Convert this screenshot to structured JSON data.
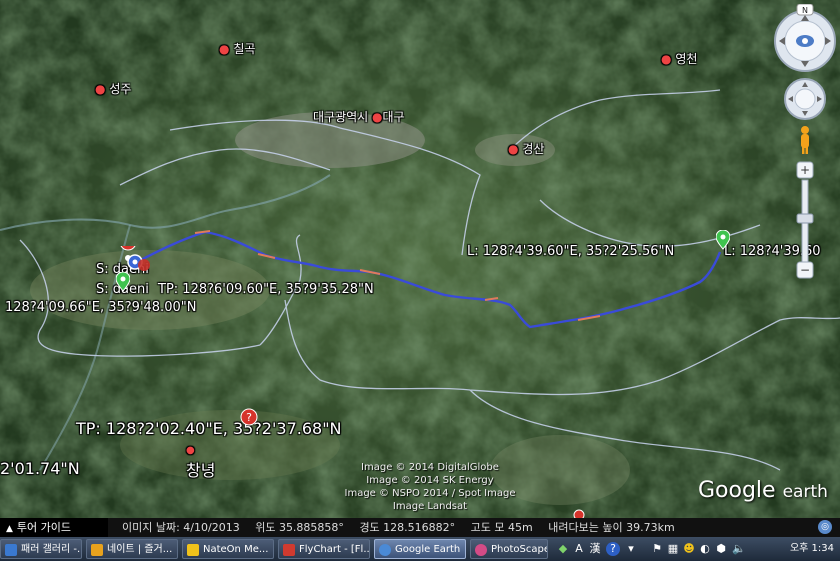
{
  "map": {
    "places": {
      "daegu_metro": "대구광역시",
      "daegu": "대구",
      "gyeongsan": "경산",
      "seongju": "성주",
      "chilgok": "칠곡",
      "yeongcheon": "영천",
      "changnyeong": "창녕"
    },
    "placemarks": {
      "start1": "S: daeni",
      "start2": "S: daeni",
      "tp_top": "TP: 128?6'09.60\"E, 35?9'35.28\"N",
      "left_coord": "128?4'09.66\"E, 35?9'48.00\"N",
      "end_label_1": "L: 128?4'39.60\"E, 35?2'25.56\"N",
      "end_label_2": "L: 128?4'39.60",
      "tp_bottom": "TP: 128?2'02.40\"E, 35?2'37.68\"N",
      "bottom_left_coord": "2'01.74\"N"
    },
    "copyright": [
      "Image © 2014 DigitalGlobe",
      "Image © 2014 SK Energy",
      "Image © NSPO 2014 / Spot Image",
      "Image Landsat"
    ],
    "logo": {
      "main": "Google",
      "sub": "earth"
    },
    "colors": {
      "track": "#3a4bd8",
      "track_accent": "#e07b5a",
      "border": "#c9d4f0",
      "pin_red": "#d6332b",
      "pin_green": "#3fc34f"
    }
  },
  "navigation": {
    "north": "N",
    "icons": [
      "look-around-icon",
      "move-icon",
      "street-view-pegman-icon"
    ],
    "zoom_in": "+",
    "zoom_out": "−"
  },
  "status": {
    "tour_guide": "투어 가이드",
    "image_date": "이미지 날짜: 4/10/2013",
    "lat": "위도  35.885858°",
    "lon": "경도  128.516882°",
    "elev": "고도 모 45m",
    "eye_alt": "내려다보는 높이  39.73km"
  },
  "taskbar": {
    "items": [
      {
        "label": "패러 갤러리 -...",
        "color": "#3a79d0"
      },
      {
        "label": "네이트 | 즐거...",
        "color": "#e8a21d"
      },
      {
        "label": "NateOn Me...",
        "color": "#f0c21b"
      },
      {
        "label": "FlyChart - [Fl...",
        "color": "#d03a2f"
      },
      {
        "label": "Google Earth",
        "color": "#4a8ad6"
      },
      {
        "label": "PhotoScape",
        "color": "#d44b86"
      }
    ],
    "ime_lang": "A",
    "ime_hanja": "漢",
    "clock": "오후 1:34"
  }
}
